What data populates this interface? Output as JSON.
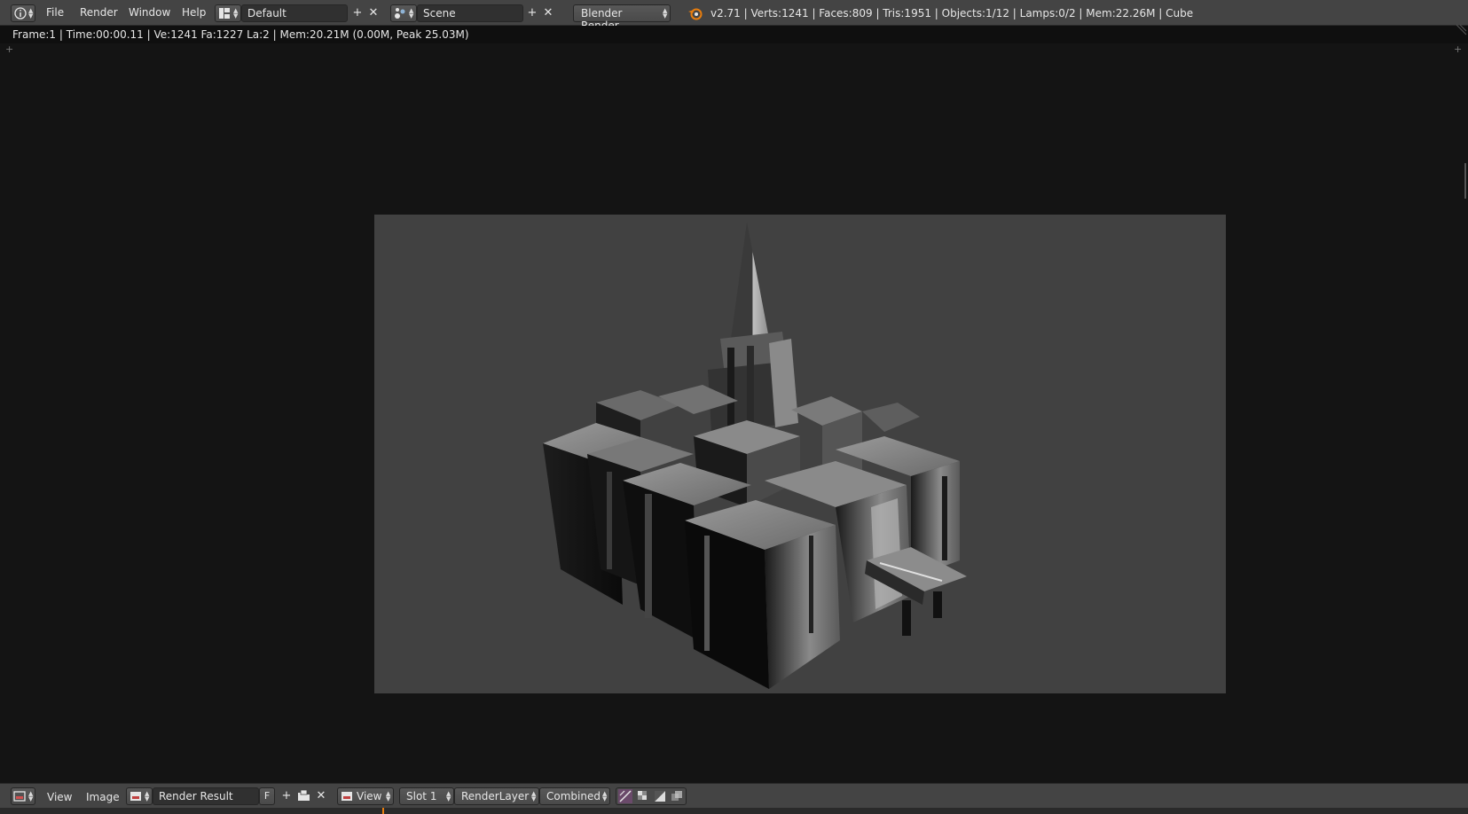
{
  "header": {
    "menus": [
      "File",
      "Render",
      "Window",
      "Help"
    ],
    "layout_name": "Default",
    "scene_name": "Scene",
    "render_engine": "Blender Render",
    "stats": "v2.71 | Verts:1241 | Faces:809 | Tris:1951 | Objects:1/12 | Lamps:0/2 | Mem:22.26M | Cube"
  },
  "render_info": "Frame:1 | Time:00:00.11 | Ve:1241 Fa:1227 La:2 | Mem:20.21M (0.00M, Peak 25.03M)",
  "footer": {
    "menus": [
      "View",
      "Image"
    ],
    "image_name": "Render Result",
    "fake_user_label": "F",
    "view_label": "View",
    "slot_label": "Slot 1",
    "render_layer": "RenderLayer",
    "pass": "Combined"
  },
  "icons": [
    "info-icon",
    "layout-icon",
    "scene-icon",
    "blender-logo-icon",
    "image-editor-icon",
    "image-browse-icon",
    "view-icon",
    "draw-alpha-icon",
    "checker-icon",
    "zbuffer-icon",
    "sample-icon"
  ],
  "colors": {
    "header_bg": "#444444",
    "viewport_bg": "#141414",
    "render_bg": "#414141",
    "accent": "#e87d0d"
  }
}
